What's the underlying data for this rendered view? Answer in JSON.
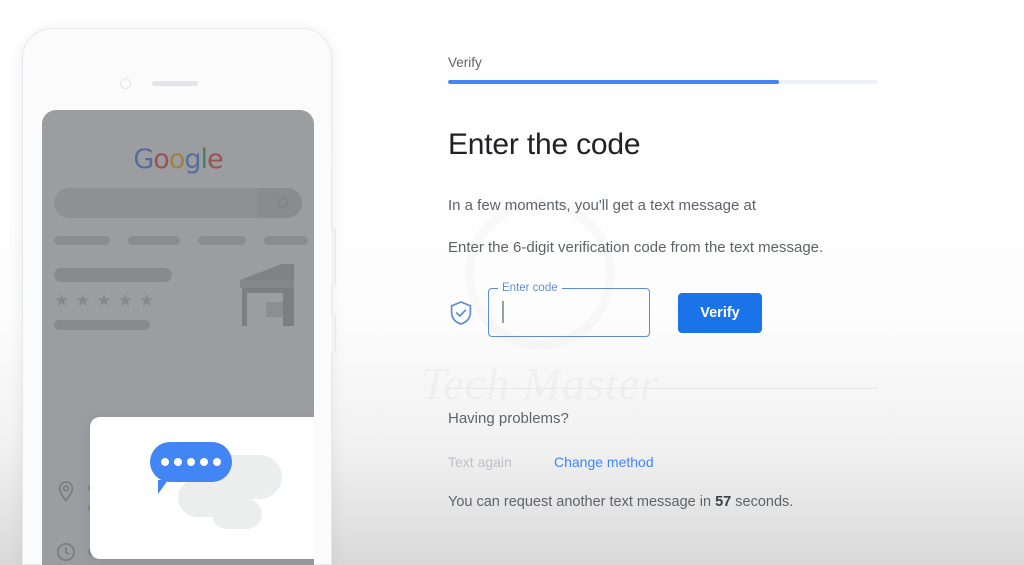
{
  "theme": {
    "accent_blue": "#4285f4",
    "button_blue": "#1a73e8",
    "field_border": "#5b8dd0",
    "text_primary": "#202124",
    "text_secondary": "#5f6368",
    "disabled_grey": "#bdc1c6"
  },
  "watermark": {
    "text": "Tech Master"
  },
  "progress": {
    "step_label": "Verify",
    "percent": 77
  },
  "main": {
    "heading": "Enter the code",
    "body_line_1": "In a few moments, you'll get a text message at",
    "body_line_2": "Enter the 6-digit verification code from the text message."
  },
  "form": {
    "shield_icon": "shield-check-icon",
    "field_label": "Enter code",
    "field_value": "",
    "field_placeholder": "",
    "verify_label": "Verify"
  },
  "help": {
    "title": "Having problems?",
    "text_again_label": "Text again",
    "change_method_label": "Change method",
    "countdown_prefix": "You can request another text message in ",
    "countdown_seconds": "57",
    "countdown_suffix": " seconds."
  },
  "phone": {
    "google_logo": {
      "letters": [
        {
          "char": "G",
          "color": "#4285f4"
        },
        {
          "char": "o",
          "color": "#ea4335"
        },
        {
          "char": "o",
          "color": "#fbbc05"
        },
        {
          "char": "g",
          "color": "#4285f4"
        },
        {
          "char": "l",
          "color": "#34a853"
        },
        {
          "char": "e",
          "color": "#ea4335"
        }
      ]
    },
    "search_icon": "magnifier-icon",
    "star_count": 5,
    "star_glyph": "★",
    "storefront_icon": "storefront-icon",
    "pin_icon": "location-pin-icon",
    "clock_icon": "clock-icon",
    "sms_card": {
      "bubble_icon": "speech-bubble-icon",
      "dot_count": 5
    }
  }
}
